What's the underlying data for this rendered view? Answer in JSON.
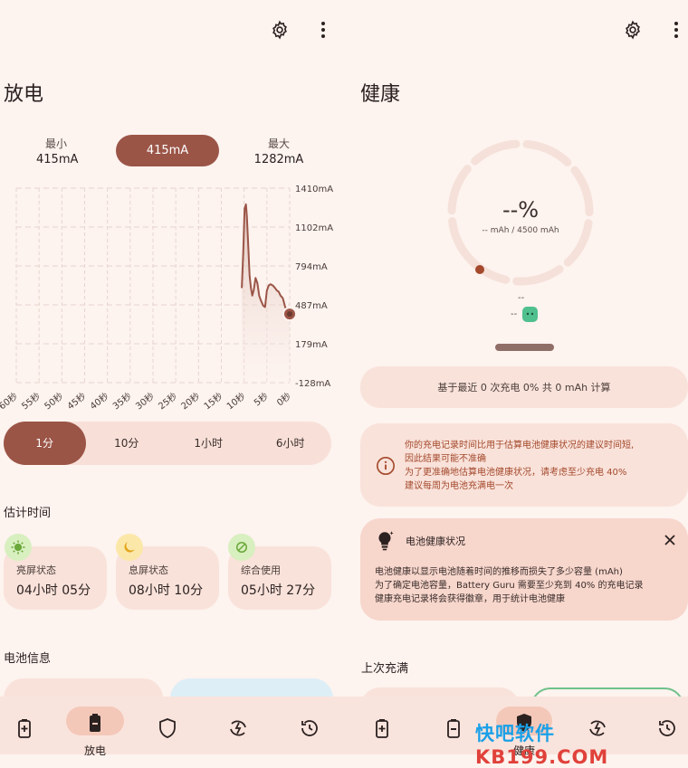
{
  "left": {
    "title": "放电",
    "stats": {
      "min_label": "最小",
      "min_value": "415mA",
      "current_value": "415mA",
      "max_label": "最大",
      "max_value": "1282mA"
    },
    "chart_data": {
      "type": "line",
      "y_tick_labels": [
        "1410mA",
        "1102mA",
        "794mA",
        "487mA",
        "179mA",
        "-128mA"
      ],
      "ylim": [
        -128,
        1410
      ],
      "x_tick_labels": [
        "60秒",
        "55秒",
        "50秒",
        "45秒",
        "40秒",
        "35秒",
        "30秒",
        "25秒",
        "20秒",
        "15秒",
        "10秒",
        "5秒",
        "0秒"
      ],
      "x_seconds": [
        10.5,
        10.2,
        9.9,
        9.6,
        9.4,
        9.1,
        8.8,
        8.5,
        8.2,
        7.9,
        7.5,
        7.1,
        6.7,
        6.3,
        5.8,
        5.4,
        5.0,
        4.6,
        4.2,
        3.7,
        3.2,
        2.8,
        2.4,
        2.0,
        1.5,
        1.0,
        0.6,
        0.2,
        0.0
      ],
      "y_values": [
        620,
        900,
        1250,
        1282,
        1190,
        960,
        720,
        620,
        560,
        600,
        700,
        660,
        560,
        520,
        480,
        470,
        600,
        640,
        650,
        640,
        620,
        600,
        590,
        560,
        540,
        470,
        440,
        430,
        415
      ],
      "grid": true
    },
    "ranges": [
      "1分",
      "10分",
      "1小时",
      "6小时"
    ],
    "estimate_title": "估计时间",
    "estimates": [
      {
        "label": "亮屏状态",
        "value": "04小时 05分"
      },
      {
        "label": "息屏状态",
        "value": "08小时 10分"
      },
      {
        "label": "综合使用",
        "value": "05小时 27分"
      }
    ],
    "battery_info_title": "电池信息",
    "nav_label": "放电"
  },
  "right": {
    "title": "健康",
    "health_percent": "--%",
    "capacity": "-- mAh / 4500 mAh",
    "dash1": "--",
    "dash2": "--",
    "basis_text": "基于最近 0 次充电 0% 共 0 mAh 计算",
    "warning_lines": [
      "你的充电记录时间比用于估算电池健康状况的建议时间短,",
      "因此结果可能不准确",
      "为了更准确地估算电池健康状况，请考虑至少充电 40%",
      "建议每周为电池充满电一次"
    ],
    "health_card_title": "电池健康状况",
    "health_card_lines": [
      "电池健康以显示电池随着时间的推移而损失了多少容量 (mAh)",
      "为了确定电池容量，Battery Guru 需要至少充到 40% 的充电记录",
      "健康充电记录将会获得徽章，用于统计电池健康"
    ],
    "last_full_title": "上次充满",
    "nav_label": "健康"
  },
  "watermark": {
    "part1": "快吧软件",
    "part2": "KB199.COM"
  },
  "colors": {
    "accent": "#9b5547",
    "background": "#fdf3ef",
    "card": "#f9e2da",
    "health_card": "#f7d6cc"
  }
}
